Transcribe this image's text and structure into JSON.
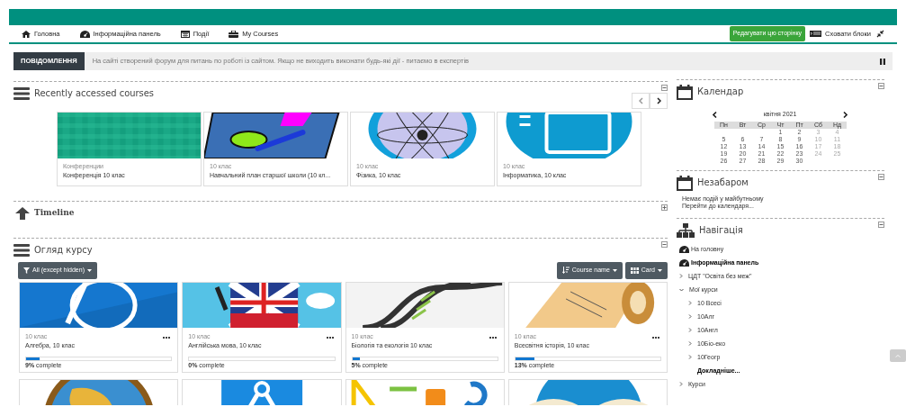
{
  "nav": {
    "items": [
      {
        "label": "Головна"
      },
      {
        "label": "Інформаційна панель"
      },
      {
        "label": "Події"
      },
      {
        "label": "My Courses"
      }
    ],
    "edit_button": "Редагувати цю сторінку",
    "hide_blocks": "Сховати блоки"
  },
  "notice": {
    "badge": "ПОВІДОМЛЕННЯ",
    "text": "На сайті створений форум для питань по роботі із сайтом. Якщо не виходить виконати будь-які дії - питаємо в експертів"
  },
  "recent": {
    "title": "Recently accessed courses",
    "courses": [
      {
        "category": "Конференции",
        "name": "Конференція 10 клас"
      },
      {
        "category": "10 клас",
        "name": "Навчальний план старшої школи (10 кл..."
      },
      {
        "category": "10 клас",
        "name": "Фізика, 10 клас"
      },
      {
        "category": "10 клас",
        "name": "Інформатика, 10 клас"
      }
    ]
  },
  "timeline": {
    "title": "Timeline"
  },
  "overview": {
    "title": "Огляд курсу",
    "filter": "All (except hidden)",
    "sort": "Course name",
    "view": "Card",
    "courses": [
      {
        "category": "10 клас",
        "name": "Алгебра, 10 клас",
        "level": 0.09,
        "progress": "**9%** complete"
      },
      {
        "category": "10 клас",
        "name": "Англійська мова, 10 клас",
        "level": 0,
        "progress": "**0%** complete"
      },
      {
        "category": "10 клас",
        "name": "Біологія та екологія 10 клас",
        "level": 0.05,
        "progress": "**5%** complete"
      },
      {
        "category": "10 клас",
        "name": "Всесвітня історія, 10 клас",
        "level": 0.13,
        "progress": "**13%** complete"
      }
    ]
  },
  "calendar": {
    "title": "Календар",
    "month": "квітня 2021",
    "weekdays": [
      "Пн",
      "Вт",
      "Ср",
      "Чт",
      "Пт",
      "Сб",
      "Нд"
    ],
    "weeks": [
      [
        "1",
        "2",
        "3",
        "4"
      ],
      [
        "5",
        "6",
        "7",
        "8",
        "9",
        "10",
        "11"
      ],
      [
        "12",
        "13",
        "14",
        "15",
        "16",
        "17",
        "18"
      ],
      [
        "19",
        "20",
        "21",
        "22",
        "23",
        "24",
        "25"
      ],
      [
        "26",
        "27",
        "28",
        "29",
        "30"
      ]
    ]
  },
  "upcoming": {
    "title": "Незабаром",
    "empty": "Немає подій у майбутньому",
    "link": "Перейти до календаря..."
  },
  "navigation": {
    "title": "Навігація",
    "items": [
      {
        "label": "На головну",
        "kind": "home"
      },
      {
        "label": "Інформаційна панель",
        "kind": "dashboard"
      },
      {
        "label": "ЦДТ \"Освіта без меж\"",
        "kind": "branch",
        "expanded": false
      },
      {
        "label": "Мої курси",
        "kind": "branch",
        "expanded": true,
        "children": [
          {
            "label": "10 Всесі",
            "kind": "branch",
            "expanded": false
          },
          {
            "label": "10Алг",
            "kind": "branch",
            "expanded": false
          },
          {
            "label": "10Англ",
            "kind": "branch",
            "expanded": false
          },
          {
            "label": "10Біо-еко",
            "kind": "branch",
            "expanded": false
          },
          {
            "label": "10Геогр",
            "kind": "branch",
            "expanded": false
          },
          {
            "label": "Докладніше...",
            "kind": "more"
          }
        ]
      },
      {
        "label": "Курси",
        "kind": "branch",
        "expanded": false
      }
    ]
  }
}
